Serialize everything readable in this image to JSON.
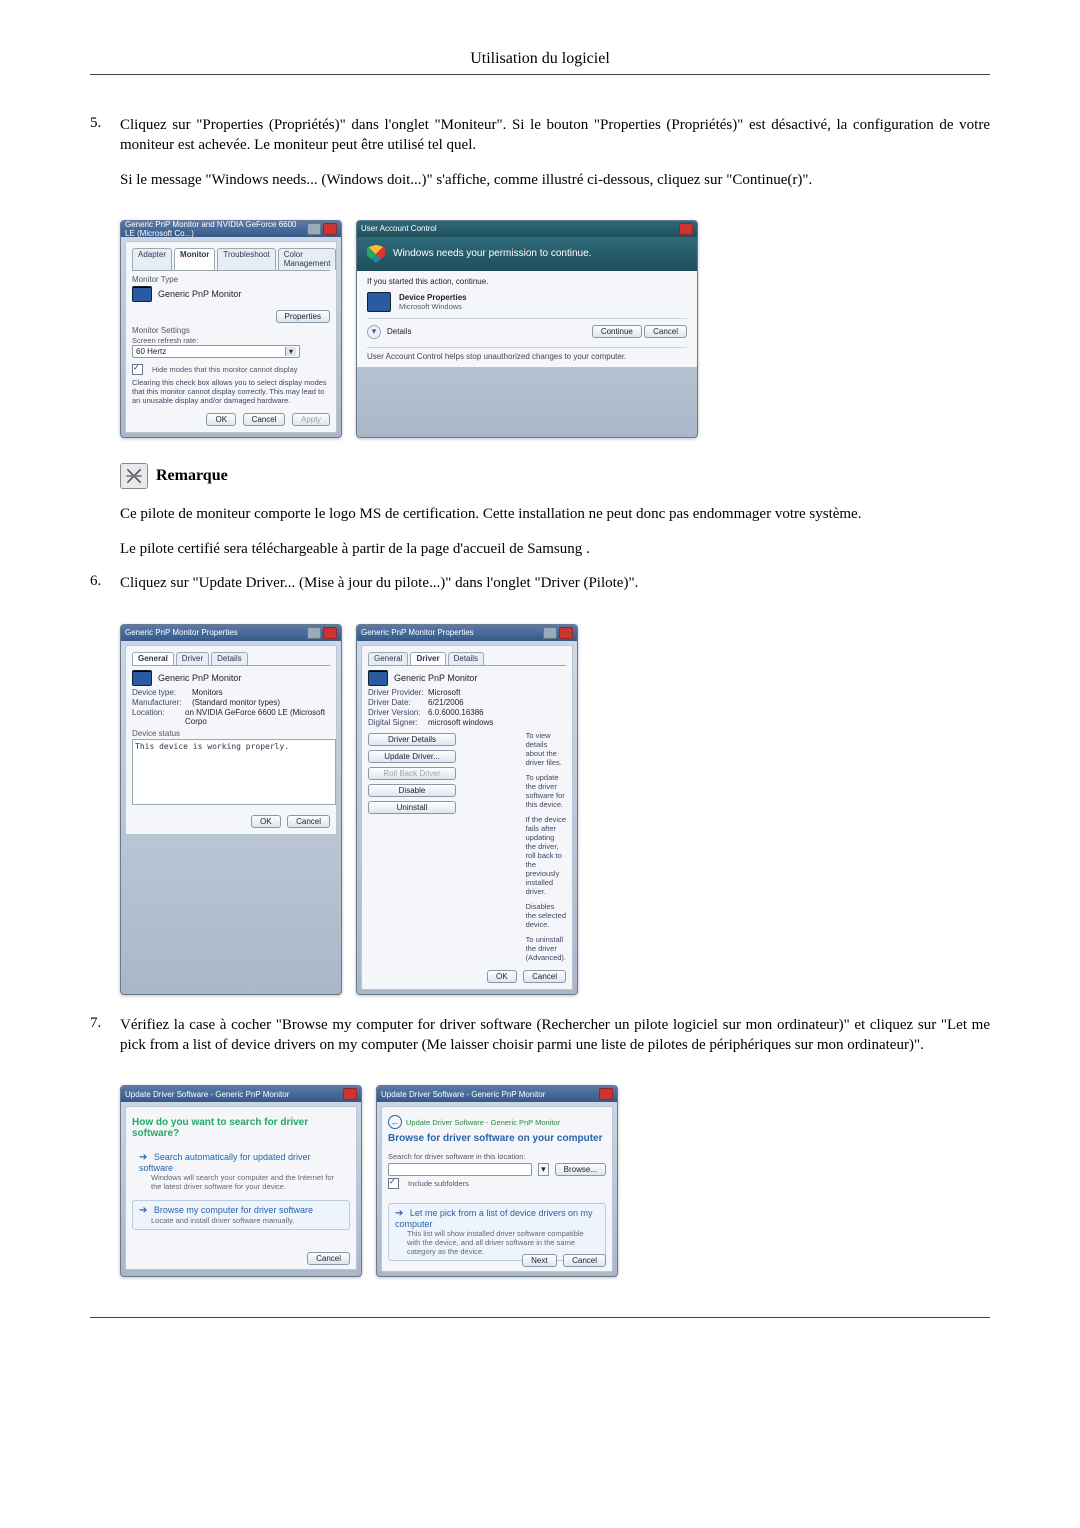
{
  "header": {
    "title": "Utilisation du logiciel"
  },
  "step5": {
    "num": "5.",
    "p1": "Cliquez sur \"Properties (Propriétés)\" dans l'onglet \"Moniteur\". Si le bouton \"Properties (Propriétés)\" est désactivé, la configuration de votre moniteur est achevée. Le moniteur peut être utilisé tel quel.",
    "p2": "Si le message \"Windows needs... (Windows doit...)\" s'affiche, comme illustré ci-dessous, cliquez sur \"Continue(r)\"."
  },
  "fig1": {
    "title": "Generic PnP Monitor and NVIDIA GeForce 6600 LE (Microsoft Co...)",
    "tabs": {
      "adapter": "Adapter",
      "monitor": "Monitor",
      "troubleshoot": "Troubleshoot",
      "color": "Color Management"
    },
    "monitor_type_lbl": "Monitor Type",
    "monitor_name": "Generic PnP Monitor",
    "properties_btn": "Properties",
    "monitor_settings_lbl": "Monitor Settings",
    "refresh_lbl": "Screen refresh rate:",
    "refresh_val": "60 Hertz",
    "hide_modes": "Hide modes that this monitor cannot display",
    "hide_modes_note": "Clearing this check box allows you to select display modes that this monitor cannot display correctly. This may lead to an unusable display and/or damaged hardware.",
    "ok": "OK",
    "cancel": "Cancel",
    "apply": "Apply"
  },
  "fig2": {
    "title": "User Account Control",
    "perm": "Windows needs your permission to continue.",
    "ifyou": "If you started this action, continue.",
    "item_title": "Device Properties",
    "item_sub": "Microsoft Windows",
    "details": "Details",
    "continue": "Continue",
    "cancel": "Cancel",
    "footer": "User Account Control helps stop unauthorized changes to your computer."
  },
  "remarque": {
    "label": "Remarque",
    "p1": "Ce pilote de moniteur comporte le logo MS de certification. Cette installation ne peut donc pas endommager votre système.",
    "p2": "Le pilote certifié sera téléchargeable à partir de la page d'accueil de Samsung ."
  },
  "step6": {
    "num": "6.",
    "p1": "Cliquez sur \"Update Driver... (Mise à jour du pilote...)\" dans l'onglet \"Driver (Pilote)\"."
  },
  "fig3": {
    "title": "Generic PnP Monitor Properties",
    "tabs": {
      "general": "General",
      "driver": "Driver",
      "details": "Details"
    },
    "monitor_name": "Generic PnP Monitor",
    "kv": {
      "devtype_k": "Device type:",
      "devtype_v": "Monitors",
      "manuf_k": "Manufacturer:",
      "manuf_v": "(Standard monitor types)",
      "loc_k": "Location:",
      "loc_v": "on NVIDIA GeForce 6600 LE (Microsoft Corpo"
    },
    "status_lbl": "Device status",
    "status_txt": "This device is working properly.",
    "ok": "OK",
    "cancel": "Cancel"
  },
  "fig4": {
    "title": "Generic PnP Monitor Properties",
    "tabs": {
      "general": "General",
      "driver": "Driver",
      "details": "Details"
    },
    "monitor_name": "Generic PnP Monitor",
    "kv": {
      "prov_k": "Driver Provider:",
      "prov_v": "Microsoft",
      "date_k": "Driver Date:",
      "date_v": "6/21/2006",
      "ver_k": "Driver Version:",
      "ver_v": "6.0.6000.16386",
      "sign_k": "Digital Signer:",
      "sign_v": "microsoft windows"
    },
    "btns": {
      "details": "Driver Details",
      "details_d": "To view details about the driver files.",
      "update": "Update Driver...",
      "update_d": "To update the driver software for this device.",
      "rollback": "Roll Back Driver",
      "rollback_d": "If the device fails after updating the driver, roll back to the previously installed driver.",
      "disable": "Disable",
      "disable_d": "Disables the selected device.",
      "uninstall": "Uninstall",
      "uninstall_d": "To uninstall the driver (Advanced)."
    },
    "ok": "OK",
    "cancel": "Cancel"
  },
  "step7": {
    "num": "7.",
    "p1": "Vérifiez la case à cocher \"Browse my computer for driver software (Rechercher un pilote logiciel sur mon ordinateur)\" et cliquez sur \"Let me pick from a list of device drivers on my computer (Me laisser choisir parmi une liste de pilotes de périphériques sur mon ordinateur)\"."
  },
  "fig5": {
    "title": "Update Driver Software - Generic PnP Monitor",
    "heading": "How do you want to search for driver software?",
    "opt1_t": "Search automatically for updated driver software",
    "opt1_d": "Windows will search your computer and the Internet for the latest driver software for your device.",
    "opt2_t": "Browse my computer for driver software",
    "opt2_d": "Locate and install driver software manually.",
    "cancel": "Cancel"
  },
  "fig6": {
    "title": "Update Driver Software - Generic PnP Monitor",
    "heading": "Browse for driver software on your computer",
    "search_lbl": "Search for driver software in this location:",
    "browse": "Browse...",
    "include": "Include subfolders",
    "opt_t": "Let me pick from a list of device drivers on my computer",
    "opt_d": "This list will show installed driver software compatible with the device, and all driver software in the same category as the device.",
    "next": "Next",
    "cancel": "Cancel"
  }
}
